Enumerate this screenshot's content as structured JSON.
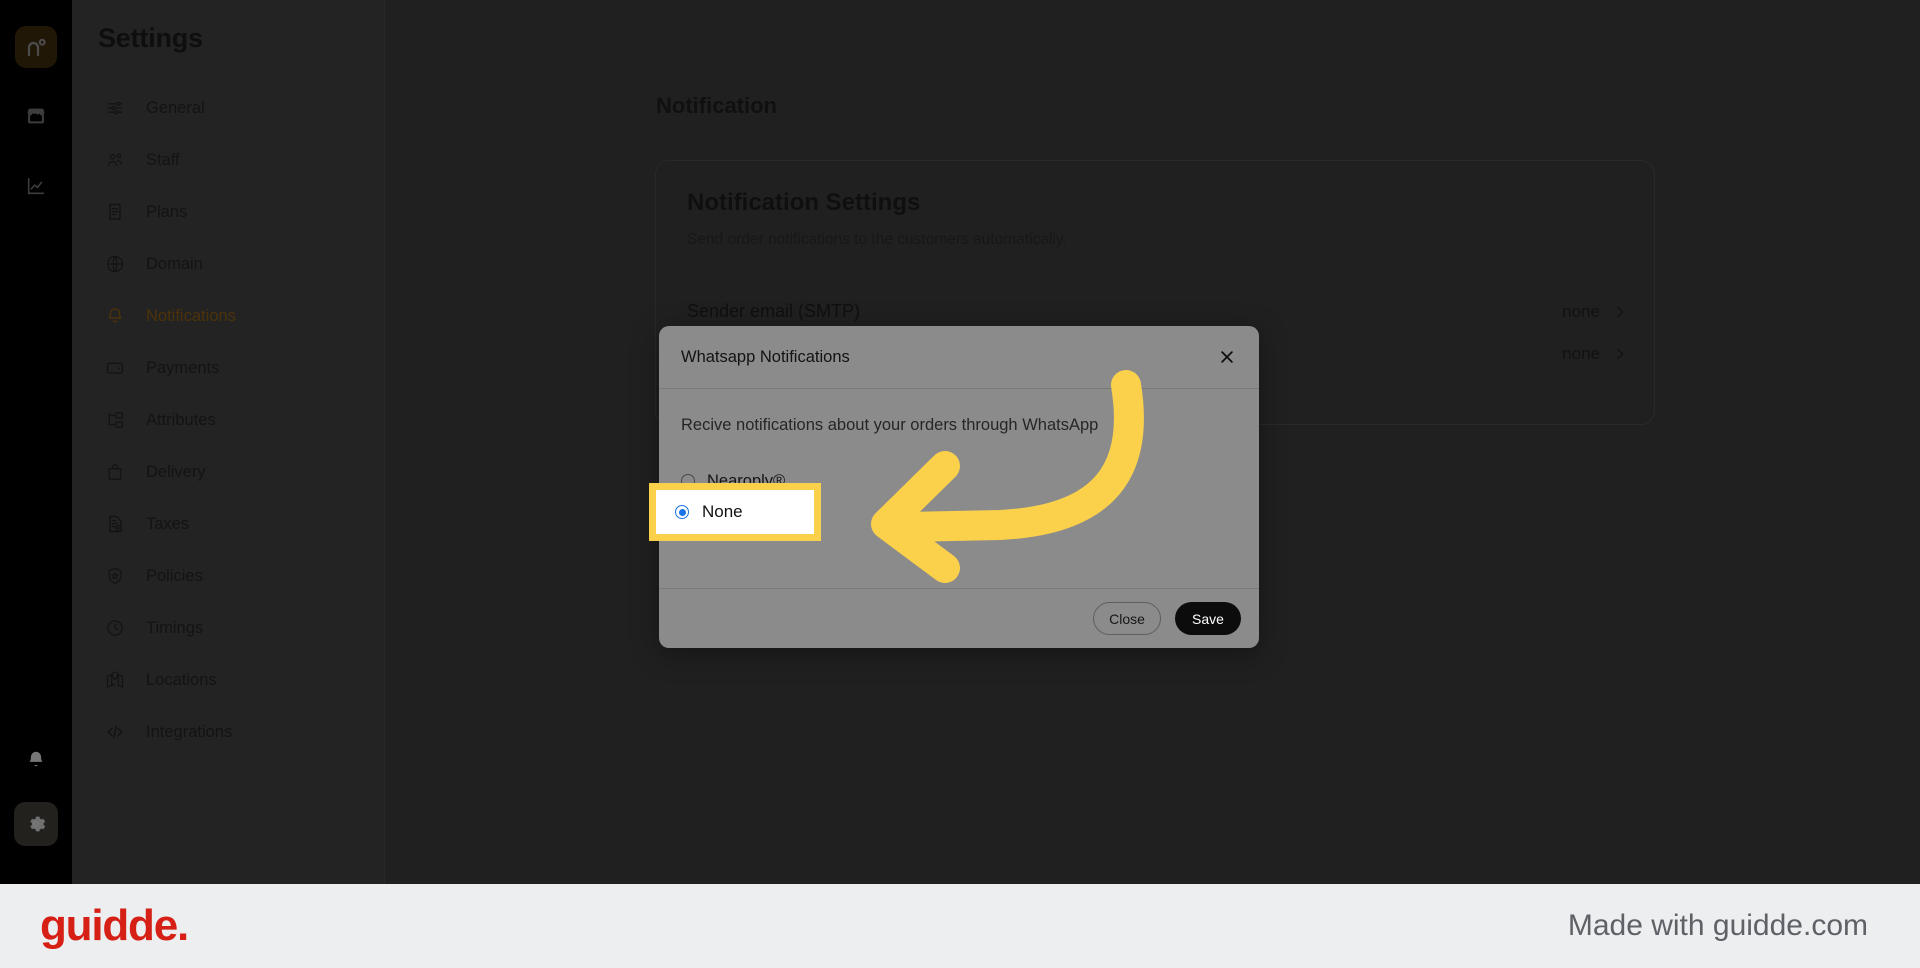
{
  "icon_rail": {
    "brand_logo": "brand-n-degree-logo",
    "items": [
      {
        "icon": "store-icon",
        "name": "store"
      },
      {
        "icon": "analytics-chart-icon",
        "name": "analytics"
      }
    ],
    "bottom": [
      {
        "icon": "bell-icon",
        "name": "notifications"
      },
      {
        "icon": "gear-icon",
        "name": "settings"
      }
    ]
  },
  "sidebar": {
    "title": "Settings",
    "items": [
      {
        "label": "General",
        "icon": "sliders-icon",
        "active": false
      },
      {
        "label": "Staff",
        "icon": "users-icon",
        "active": false
      },
      {
        "label": "Plans",
        "icon": "receipt-icon",
        "active": false
      },
      {
        "label": "Domain",
        "icon": "globe-icon",
        "active": false
      },
      {
        "label": "Notifications",
        "icon": "bell-icon",
        "active": true
      },
      {
        "label": "Payments",
        "icon": "wallet-icon",
        "active": false
      },
      {
        "label": "Attributes",
        "icon": "hierarchy-icon",
        "active": false
      },
      {
        "label": "Delivery",
        "icon": "bag-icon",
        "active": false
      },
      {
        "label": "Taxes",
        "icon": "tax-doc-icon",
        "active": false
      },
      {
        "label": "Policies",
        "icon": "shield-icon",
        "active": false
      },
      {
        "label": "Timings",
        "icon": "clock-icon",
        "active": false
      },
      {
        "label": "Locations",
        "icon": "map-icon",
        "active": false
      },
      {
        "label": "Integrations",
        "icon": "code-icon",
        "active": false
      }
    ]
  },
  "main": {
    "page_title": "Notification",
    "card": {
      "title": "Notification Settings",
      "subtitle": "Send order notifications to the customers automatically.",
      "rows": [
        {
          "label": "Sender email (SMTP)",
          "value": "none",
          "chevron": "chevron-right-icon"
        },
        {
          "label": "",
          "value": "none",
          "chevron": "chevron-right-icon"
        }
      ]
    }
  },
  "modal": {
    "title": "Whatsapp Notifications",
    "close_icon": "close-x-icon",
    "description": "Recive notifications about your orders through WhatsApp",
    "options": [
      {
        "label": "Nearoply®",
        "selected": false
      },
      {
        "label": "None",
        "selected": true
      }
    ],
    "buttons": {
      "close": "Close",
      "save": "Save"
    }
  },
  "annotation": {
    "highlight_target": "None",
    "highlight_color": "#fbd14b",
    "arrow_color": "#fbd14b",
    "arrow_direction": "left"
  },
  "footer": {
    "logo_text": "guidde.",
    "logo_color": "#d61f15",
    "made_with": "Made with guidde.com"
  }
}
